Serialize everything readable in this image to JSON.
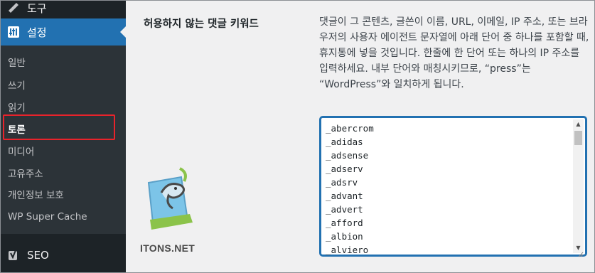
{
  "sidebar": {
    "tools_label": "도구",
    "settings_label": "설정",
    "submenu": [
      "일반",
      "쓰기",
      "읽기",
      "토론",
      "미디어",
      "고유주소",
      "개인정보 보호",
      "WP Super Cache"
    ],
    "current_index": 3,
    "seo_label": "SEO"
  },
  "main": {
    "field_label": "허용하지 않는 댓글 키워드",
    "description": "댓글이 그 콘텐츠, 글쓴이 이름, URL, 이메일, IP 주소, 또는 브라우저의 사용자 에이전트 문자열에 아래 단어 중 하나를 포함할 때, 휴지통에 넣을 것입니다. 한줄에 한 단어 또는 하나의 IP 주소를 입력하세요. 내부 단어와 매칭시키므로, “press”는 “WordPress”와 일치하게 됩니다.",
    "keywords": [
      "_abercrom",
      "_adidas",
      "_adsense",
      "_adserv",
      "_adsrv",
      "_advant",
      "_advert",
      "_afford",
      "_albion",
      "_alviero"
    ]
  },
  "watermark": {
    "text": "ITONS.NET"
  },
  "colors": {
    "sidebar": "#1d2327",
    "submenu": "#2c3338",
    "accent": "#2271b1",
    "highlight": "#e8232b"
  }
}
